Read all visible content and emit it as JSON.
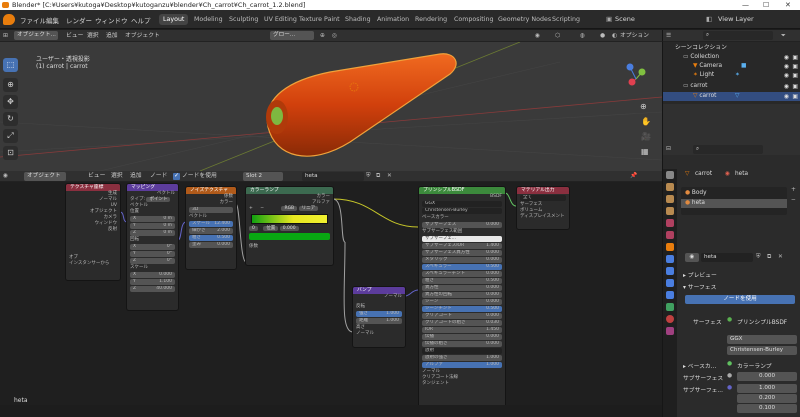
{
  "titlebar": {
    "title": "Blender* [C:¥Users¥kutoga¥Desktop¥kutoganzu¥blender¥Ch_carrot¥Ch_carrot_1.2.blend]",
    "min": "—",
    "max": "☐",
    "close": "✕"
  },
  "menu": [
    "ファイル",
    "編集",
    "レンダー",
    "ウィンドウ",
    "ヘルプ"
  ],
  "workspaces": [
    "Layout",
    "Modeling",
    "Sculpting",
    "UV Editing",
    "Texture Paint",
    "Shading",
    "Animation",
    "Rendering",
    "Compositing",
    "Geometry Nodes",
    "Scripting"
  ],
  "scene": {
    "label": "Scene",
    "view_layer": "View Layer"
  },
  "viewport": {
    "mode": "オブジェクト...",
    "menus": [
      "ビュー",
      "選択",
      "追加",
      "オブジェクト"
    ],
    "orientation": "グロー...",
    "options": "オプション",
    "view_name": "ユーザー・透視投影",
    "object_name": "(1) carrot | carrot"
  },
  "node_editor": {
    "mode": "オブジェクト",
    "menus": [
      "ビュー",
      "選択",
      "追加",
      "ノード"
    ],
    "use_nodes": "ノードを使用",
    "slot": "Slot 2",
    "material": "heta",
    "nodes": {
      "texcoord": {
        "title": "テクスチャ座標",
        "outputs": [
          "生成",
          "ノーマル",
          "UV",
          "オブジェクト",
          "カメラ",
          "ウィンドウ",
          "反射"
        ],
        "obj_label": "オブ",
        "instancer": "インスタンサーから"
      },
      "mapping": {
        "title": "マッピング",
        "out": "ベクトル",
        "type_label": "タイプ:",
        "type": "ポイント",
        "vector": "ベクトル",
        "loc": "位置",
        "loc_vals": [
          "0 m",
          "0 m",
          "0 m"
        ],
        "rot": "回転",
        "rot_vals": [
          "0°",
          "0°",
          "0°"
        ],
        "scale": "スケール",
        "scale_vals": [
          "0.000",
          "1.100",
          "40.000"
        ]
      },
      "noise": {
        "title": "ノイズテクスチャ",
        "outs": [
          "係数",
          "カラー"
        ],
        "dim": "3D",
        "vec": "ベクトル",
        "fields": [
          {
            "k": "スケール",
            "v": "12.400"
          },
          {
            "k": "細かさ",
            "v": "2.000"
          },
          {
            "k": "粗さ",
            "v": "0.500"
          },
          {
            "k": "歪み",
            "v": "0.000"
          }
        ]
      },
      "ramp": {
        "title": "カラーランプ",
        "outs": [
          "カラー",
          "アルファ"
        ],
        "mode": "RGB",
        "interp": "リニア",
        "pos_label": "0",
        "pos": "位置",
        "pos_val": "0.000",
        "fac": "係数"
      },
      "bump": {
        "title": "バンプ",
        "out": "ノーマル",
        "invert": "反転",
        "fields": [
          {
            "k": "強さ",
            "v": "1.000"
          },
          {
            "k": "距離",
            "v": "1.000"
          }
        ],
        "inputs": [
          "高さ",
          "ノーマル"
        ]
      },
      "bsdf": {
        "title": "プリンシプルBSDF",
        "out": "BSDF",
        "dist": "GGX",
        "sss": "Christensen-Burley",
        "rows": [
          {
            "k": "ベースカラー",
            "v": ""
          },
          {
            "k": "サブサーフェス",
            "v": "0.000"
          },
          {
            "k": "サブサーフェス範囲",
            "v": ""
          },
          {
            "k": "サブサーフェ...",
            "v": ""
          },
          {
            "k": "サブサーフェスIOR",
            "v": "1.400"
          },
          {
            "k": "サブサーフェス異方性",
            "v": "0.000"
          },
          {
            "k": "メタリック",
            "v": "0.000"
          },
          {
            "k": "スペキュラー",
            "v": "0.500"
          },
          {
            "k": "スペキュラーチント",
            "v": "0.000"
          },
          {
            "k": "粗さ",
            "v": "0.500"
          },
          {
            "k": "異方性",
            "v": "0.000"
          },
          {
            "k": "異方性の回転",
            "v": "0.000"
          },
          {
            "k": "シーン",
            "v": "0.000"
          },
          {
            "k": "シーンチント",
            "v": "0.500"
          },
          {
            "k": "クリアコート",
            "v": "0.000"
          },
          {
            "k": "クリアコートの粗さ",
            "v": "0.030"
          },
          {
            "k": "IOR",
            "v": "1.450"
          },
          {
            "k": "伝播",
            "v": "0.000"
          },
          {
            "k": "伝播の粗さ",
            "v": "0.000"
          },
          {
            "k": "放射",
            "v": ""
          },
          {
            "k": "放射の強さ",
            "v": "1.000"
          },
          {
            "k": "アルファ",
            "v": "1.000"
          },
          {
            "k": "ノーマル",
            "v": ""
          },
          {
            "k": "クリアコート法線",
            "v": ""
          },
          {
            "k": "タンジェント",
            "v": ""
          }
        ]
      },
      "output": {
        "title": "マテリアル出力",
        "target": "全て",
        "inputs": [
          "サーフェス",
          "ボリューム",
          "ディスプレイスメント"
        ]
      }
    }
  },
  "outliner": {
    "header": "シーンコレクション",
    "items": [
      {
        "name": "Collection"
      },
      {
        "name": "Camera"
      },
      {
        "name": "Light"
      },
      {
        "name": "carrot"
      },
      {
        "name": "carrot"
      }
    ]
  },
  "properties": {
    "object": "carrot",
    "material": "heta",
    "slots": [
      "Body",
      "heta"
    ],
    "mat_field": "heta",
    "preview": "プレビュー",
    "surface_panel": "サーフェス",
    "use_nodes_btn": "ノードを使用",
    "surface_label": "サーフェス",
    "surface_value": "プリンシプルBSDF",
    "dist": "GGX",
    "sss": "Christensen-Burley",
    "base_label": "ベースカ...",
    "base_value": "カラーランプ",
    "sss_label": "サブサーフェス",
    "sss_value": "0.000",
    "sss_range_label": "サブサーフェ...",
    "range_vals": [
      "1.000",
      "0.200",
      "0.100"
    ]
  },
  "status": {
    "text": "heta"
  },
  "colors": {
    "accent": "#4772b3",
    "orange": "#e87d0d",
    "carrot": "#d1400c"
  }
}
